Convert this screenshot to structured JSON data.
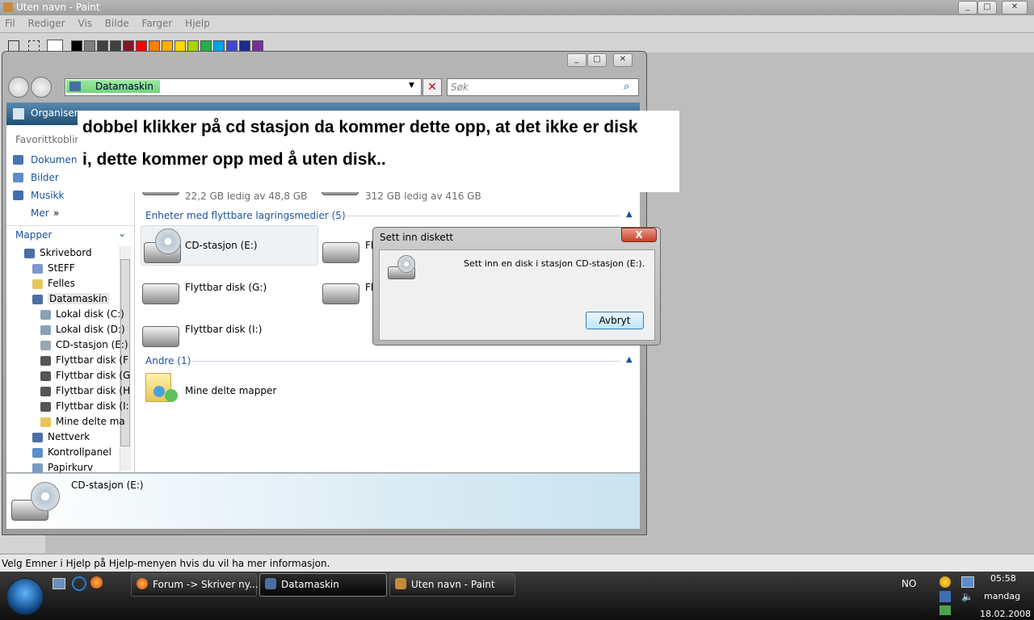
{
  "paint": {
    "title": "Uten navn - Paint",
    "menu": [
      "Fil",
      "Rediger",
      "Vis",
      "Bilde",
      "Farger",
      "Hjelp"
    ],
    "status": "Velg Emner i Hjelp på Hjelp-menyen hvis du vil ha mer informasjon.",
    "palette": [
      "#000000",
      "#7f7f7f",
      "#404040",
      "#404040",
      "#7f1a2a",
      "#ff0000",
      "#ff7f00",
      "#ffb000",
      "#ffd800",
      "#a8d400",
      "#22b14c",
      "#00a2e8",
      "#3f48cc",
      "#1e2a8c",
      "#7a2f9a"
    ]
  },
  "explorer": {
    "address": "Datamaskin",
    "search_placeholder": "Søk",
    "organize": "Organiser",
    "favorites_header": "Favorittkobling",
    "favorites": [
      "Dokumente",
      "Bilder",
      "Musikk",
      "Mer"
    ],
    "folders_header": "Mapper",
    "tree": [
      "Skrivebord",
      "StEFF",
      "Felles",
      "Datamaskin",
      "Lokal disk (C:)",
      "Lokal disk (D:)",
      "CD-stasjon (E:)",
      "Flyttbar disk (F",
      "Flyttbar disk (G",
      "Flyttbar disk (H",
      "Flyttbar disk (I:",
      "Mine delte ma",
      "Nettverk",
      "Kontrollpanel",
      "Papirkurv"
    ],
    "drive_c_free": "22,2 GB ledig av 48,8 GB",
    "drive_d_free": "312 GB ledig av 416 GB",
    "removable_group": "Enheter med flyttbare lagringsmedier (5)",
    "removable_items": [
      "CD-stasjon (E:)",
      "Fl",
      "Flyttbar disk (G:)",
      "Fl",
      "Flyttbar disk (I:)"
    ],
    "other_group": "Andre (1)",
    "other_items": [
      "Mine delte mapper"
    ],
    "details_name": "CD-stasjon (E:)"
  },
  "annotation": {
    "line1": "dobbel klikker på cd stasjon da kommer dette opp, at det ikke er disk",
    "line2": "i, dette kommer opp med å uten disk.."
  },
  "dialog": {
    "title": "Sett inn diskett",
    "close": "X",
    "message": "Sett inn en disk i stasjon CD-stasjon (E:).",
    "button": "Avbryt"
  },
  "taskbar": {
    "buttons": [
      "Forum -> Skriver ny...",
      "Datamaskin",
      "Uten navn - Paint"
    ],
    "lang": "NO",
    "time": "05:58",
    "day": "mandag",
    "date": "18.02.2008"
  }
}
